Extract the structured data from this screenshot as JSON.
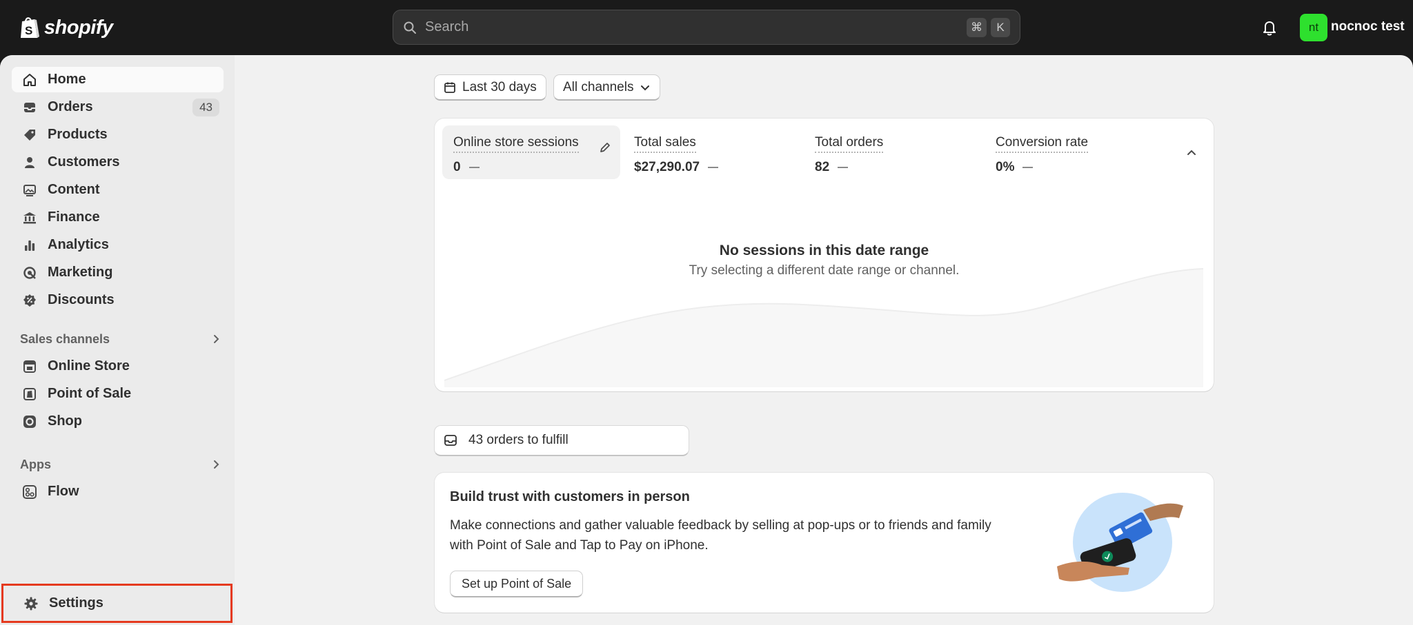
{
  "topbar": {
    "brand": "shopify",
    "search_placeholder": "Search",
    "shortcut_cmd": "⌘",
    "shortcut_key": "K",
    "avatar_initials": "nt",
    "store_name": "nocnoc test",
    "avatar_color": "#2ee02e"
  },
  "sidebar": {
    "items": [
      {
        "label": "Home",
        "icon": "home-icon",
        "active": true
      },
      {
        "label": "Orders",
        "icon": "inbox-icon",
        "badge": "43"
      },
      {
        "label": "Products",
        "icon": "tag-icon"
      },
      {
        "label": "Customers",
        "icon": "person-icon"
      },
      {
        "label": "Content",
        "icon": "image-icon"
      },
      {
        "label": "Finance",
        "icon": "bank-icon"
      },
      {
        "label": "Analytics",
        "icon": "bar-chart-icon"
      },
      {
        "label": "Marketing",
        "icon": "target-icon"
      },
      {
        "label": "Discounts",
        "icon": "discount-icon"
      }
    ],
    "sales_channels_title": "Sales channels",
    "sales_channels": [
      {
        "label": "Online Store",
        "icon": "storefront-icon"
      },
      {
        "label": "Point of Sale",
        "icon": "pos-icon"
      },
      {
        "label": "Shop",
        "icon": "shop-icon"
      }
    ],
    "apps_title": "Apps",
    "apps": [
      {
        "label": "Flow",
        "icon": "flow-icon"
      }
    ],
    "settings_label": "Settings",
    "highlight_color": "#e53a1f"
  },
  "filters": {
    "date_range": "Last 30 days",
    "channels": "All channels"
  },
  "metrics": [
    {
      "label": "Online store sessions",
      "value": "0"
    },
    {
      "label": "Total sales",
      "value": "$27,290.07"
    },
    {
      "label": "Total orders",
      "value": "82"
    },
    {
      "label": "Conversion rate",
      "value": "0%"
    }
  ],
  "empty_state": {
    "title": "No sessions in this date range",
    "subtitle": "Try selecting a different date range or channel."
  },
  "fulfill": {
    "label": "43 orders to fulfill"
  },
  "promo": {
    "title": "Build trust with customers in person",
    "body": "Make connections and gather valuable feedback by selling at pop-ups or to friends and family with Point of Sale and Tap to Pay on iPhone.",
    "button": "Set up Point of Sale"
  }
}
